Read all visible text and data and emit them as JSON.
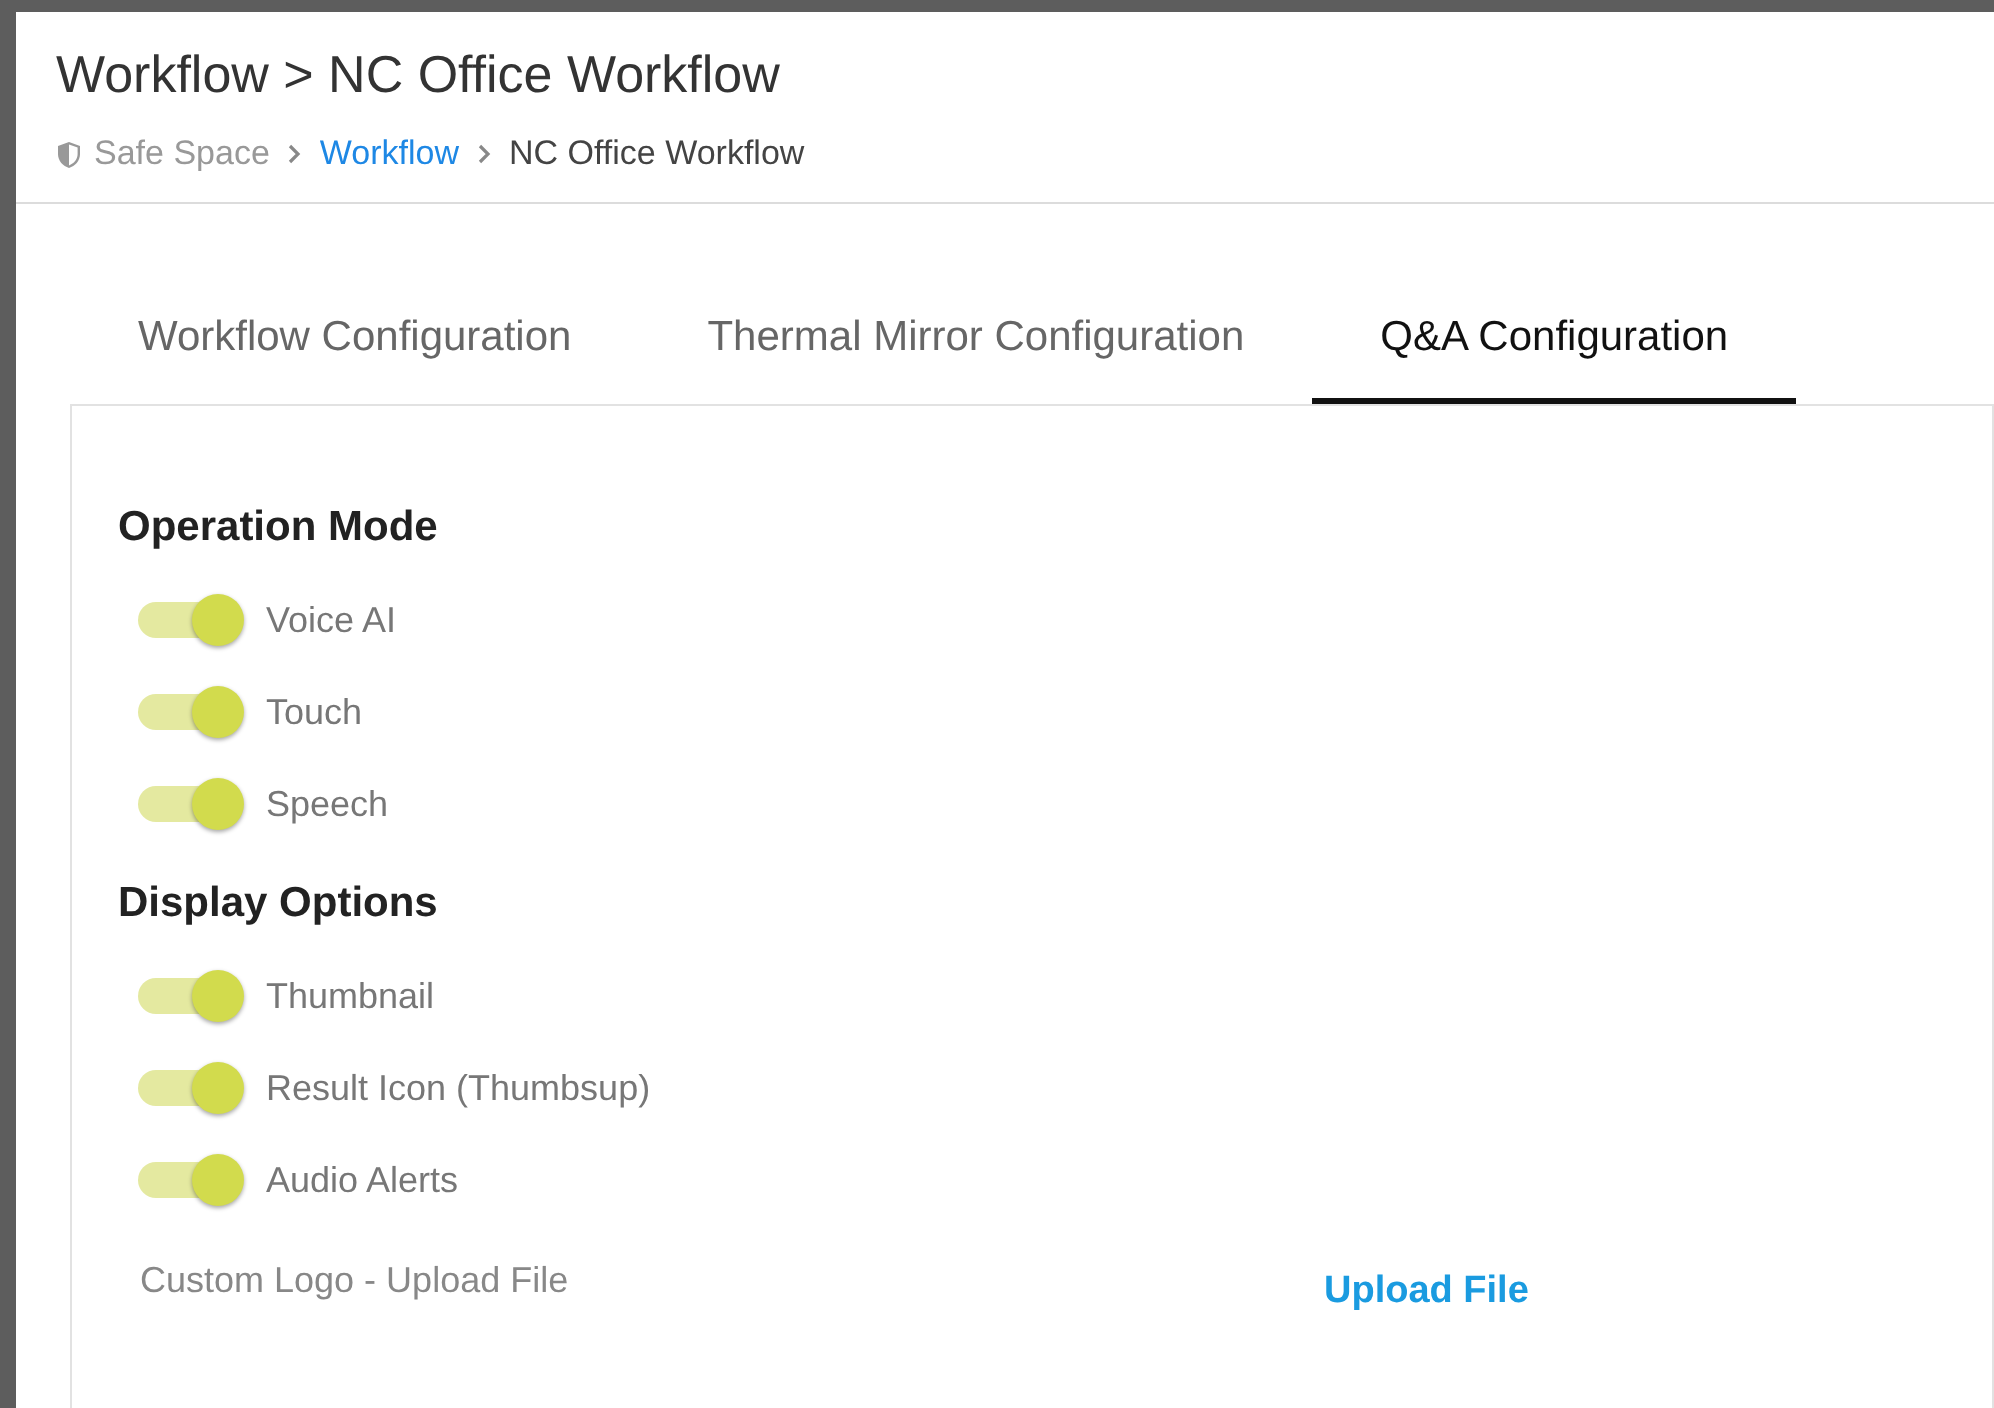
{
  "page": {
    "title": "Workflow > NC Office Workflow"
  },
  "breadcrumb": [
    {
      "label": "Safe Space",
      "kind": "root"
    },
    {
      "label": "Workflow",
      "kind": "link"
    },
    {
      "label": "NC Office Workflow",
      "kind": "current"
    }
  ],
  "tabs": [
    {
      "label": "Workflow Configuration",
      "selected": false
    },
    {
      "label": "Thermal Mirror Configuration",
      "selected": false
    },
    {
      "label": "Q&A Configuration",
      "selected": true
    }
  ],
  "sections": [
    {
      "heading": "Operation Mode",
      "toggles": [
        {
          "label": "Voice AI",
          "on": true
        },
        {
          "label": "Touch",
          "on": true
        },
        {
          "label": "Speech",
          "on": true
        }
      ]
    },
    {
      "heading": "Display Options",
      "toggles": [
        {
          "label": "Thumbnail",
          "on": true
        },
        {
          "label": "Result Icon (Thumbsup)",
          "on": true
        },
        {
          "label": "Audio Alerts",
          "on": true
        }
      ]
    }
  ],
  "upload": {
    "label": "Custom Logo - Upload File",
    "button": "Upload File"
  }
}
